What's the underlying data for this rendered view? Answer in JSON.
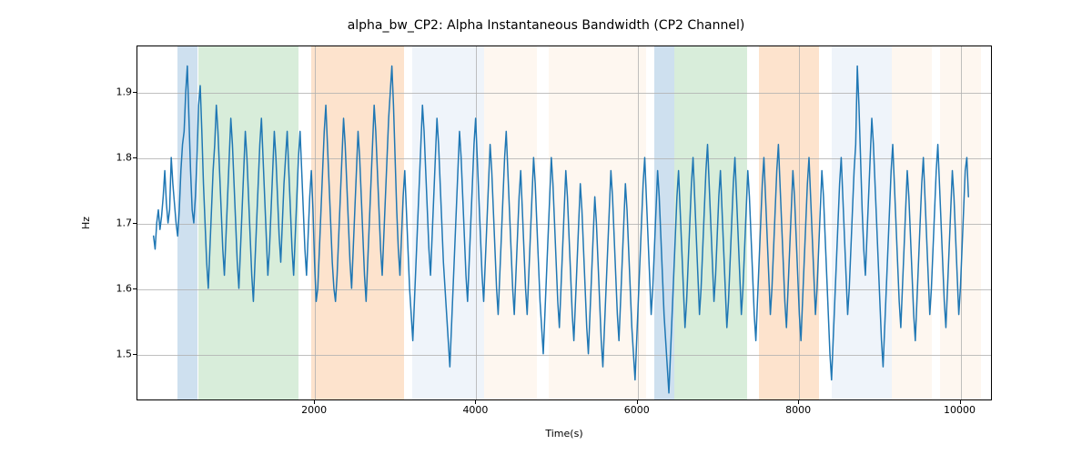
{
  "chart_data": {
    "type": "line",
    "title": "alpha_bw_CP2: Alpha Instantaneous Bandwidth (CP2 Channel)",
    "xlabel": "Time(s)",
    "ylabel": "Hz",
    "xlim": [
      -200,
      10400
    ],
    "ylim": [
      1.43,
      1.97
    ],
    "xticks": [
      2000,
      4000,
      6000,
      8000,
      10000
    ],
    "yticks": [
      1.5,
      1.6,
      1.7,
      1.8,
      1.9
    ],
    "grid": true,
    "line_color": "#1f77b4",
    "bands": [
      {
        "xmin": 300,
        "xmax": 550,
        "color": "#5e97c9"
      },
      {
        "xmin": 550,
        "xmax": 1800,
        "color": "#7dc383"
      },
      {
        "xmin": 1950,
        "xmax": 3100,
        "color": "#f7a15a"
      },
      {
        "xmin": 3200,
        "xmax": 4100,
        "color": "#c9dbee"
      },
      {
        "xmin": 4100,
        "xmax": 4750,
        "color": "#fde4cd"
      },
      {
        "xmin": 4900,
        "xmax": 6100,
        "color": "#fde4cd"
      },
      {
        "xmin": 6200,
        "xmax": 6450,
        "color": "#5e97c9"
      },
      {
        "xmin": 6450,
        "xmax": 7350,
        "color": "#7dc383"
      },
      {
        "xmin": 7500,
        "xmax": 8250,
        "color": "#f7a15a"
      },
      {
        "xmin": 8400,
        "xmax": 9150,
        "color": "#c9dbee"
      },
      {
        "xmin": 9150,
        "xmax": 9650,
        "color": "#fde4cd"
      },
      {
        "xmin": 9750,
        "xmax": 10250,
        "color": "#fde4cd"
      }
    ],
    "series": [
      {
        "name": "alpha_bw_CP2",
        "x_start": 0,
        "x_step": 20,
        "values": [
          1.68,
          1.66,
          1.7,
          1.72,
          1.69,
          1.71,
          1.74,
          1.78,
          1.73,
          1.7,
          1.72,
          1.8,
          1.76,
          1.73,
          1.7,
          1.68,
          1.72,
          1.78,
          1.82,
          1.84,
          1.9,
          1.94,
          1.86,
          1.78,
          1.72,
          1.7,
          1.74,
          1.8,
          1.88,
          1.91,
          1.84,
          1.76,
          1.7,
          1.64,
          1.6,
          1.66,
          1.72,
          1.78,
          1.82,
          1.88,
          1.84,
          1.78,
          1.72,
          1.66,
          1.62,
          1.68,
          1.74,
          1.8,
          1.86,
          1.82,
          1.76,
          1.7,
          1.64,
          1.6,
          1.66,
          1.72,
          1.78,
          1.84,
          1.8,
          1.74,
          1.68,
          1.62,
          1.58,
          1.64,
          1.7,
          1.76,
          1.82,
          1.86,
          1.8,
          1.74,
          1.68,
          1.62,
          1.66,
          1.72,
          1.78,
          1.84,
          1.8,
          1.74,
          1.68,
          1.64,
          1.7,
          1.76,
          1.8,
          1.84,
          1.78,
          1.72,
          1.66,
          1.62,
          1.68,
          1.74,
          1.8,
          1.84,
          1.78,
          1.72,
          1.66,
          1.62,
          1.68,
          1.74,
          1.78,
          1.72,
          1.64,
          1.58,
          1.6,
          1.66,
          1.72,
          1.78,
          1.84,
          1.88,
          1.82,
          1.76,
          1.7,
          1.64,
          1.6,
          1.58,
          1.62,
          1.68,
          1.74,
          1.8,
          1.86,
          1.82,
          1.76,
          1.7,
          1.64,
          1.6,
          1.66,
          1.72,
          1.78,
          1.84,
          1.8,
          1.74,
          1.68,
          1.62,
          1.58,
          1.64,
          1.7,
          1.76,
          1.82,
          1.88,
          1.84,
          1.78,
          1.72,
          1.66,
          1.62,
          1.68,
          1.74,
          1.8,
          1.86,
          1.9,
          1.94,
          1.88,
          1.8,
          1.72,
          1.66,
          1.62,
          1.68,
          1.74,
          1.78,
          1.72,
          1.66,
          1.6,
          1.56,
          1.52,
          1.58,
          1.64,
          1.7,
          1.76,
          1.82,
          1.88,
          1.84,
          1.78,
          1.72,
          1.66,
          1.62,
          1.68,
          1.74,
          1.8,
          1.86,
          1.82,
          1.76,
          1.7,
          1.64,
          1.6,
          1.56,
          1.52,
          1.48,
          1.54,
          1.6,
          1.66,
          1.72,
          1.78,
          1.84,
          1.8,
          1.74,
          1.68,
          1.62,
          1.58,
          1.64,
          1.7,
          1.76,
          1.82,
          1.86,
          1.8,
          1.74,
          1.68,
          1.62,
          1.58,
          1.64,
          1.7,
          1.76,
          1.82,
          1.78,
          1.72,
          1.66,
          1.6,
          1.56,
          1.62,
          1.68,
          1.74,
          1.8,
          1.84,
          1.78,
          1.72,
          1.66,
          1.6,
          1.56,
          1.62,
          1.68,
          1.74,
          1.78,
          1.72,
          1.66,
          1.6,
          1.56,
          1.62,
          1.68,
          1.74,
          1.8,
          1.76,
          1.7,
          1.64,
          1.58,
          1.54,
          1.5,
          1.56,
          1.62,
          1.68,
          1.74,
          1.8,
          1.76,
          1.7,
          1.64,
          1.58,
          1.54,
          1.6,
          1.66,
          1.72,
          1.78,
          1.74,
          1.68,
          1.62,
          1.56,
          1.52,
          1.58,
          1.64,
          1.7,
          1.76,
          1.72,
          1.66,
          1.6,
          1.54,
          1.5,
          1.56,
          1.62,
          1.68,
          1.74,
          1.7,
          1.64,
          1.58,
          1.52,
          1.48,
          1.54,
          1.6,
          1.66,
          1.72,
          1.78,
          1.74,
          1.68,
          1.62,
          1.56,
          1.52,
          1.58,
          1.64,
          1.7,
          1.76,
          1.72,
          1.66,
          1.6,
          1.54,
          1.5,
          1.46,
          1.52,
          1.58,
          1.64,
          1.7,
          1.76,
          1.8,
          1.74,
          1.68,
          1.62,
          1.56,
          1.6,
          1.66,
          1.72,
          1.78,
          1.74,
          1.68,
          1.62,
          1.56,
          1.52,
          1.48,
          1.44,
          1.5,
          1.56,
          1.62,
          1.68,
          1.74,
          1.78,
          1.72,
          1.66,
          1.6,
          1.54,
          1.58,
          1.64,
          1.7,
          1.76,
          1.8,
          1.74,
          1.68,
          1.62,
          1.56,
          1.6,
          1.66,
          1.72,
          1.78,
          1.82,
          1.76,
          1.7,
          1.64,
          1.58,
          1.62,
          1.68,
          1.74,
          1.78,
          1.72,
          1.66,
          1.6,
          1.54,
          1.58,
          1.64,
          1.7,
          1.76,
          1.8,
          1.74,
          1.68,
          1.62,
          1.56,
          1.6,
          1.66,
          1.72,
          1.78,
          1.74,
          1.68,
          1.62,
          1.56,
          1.52,
          1.58,
          1.64,
          1.7,
          1.76,
          1.8,
          1.74,
          1.68,
          1.62,
          1.56,
          1.6,
          1.66,
          1.72,
          1.78,
          1.82,
          1.76,
          1.7,
          1.64,
          1.58,
          1.54,
          1.6,
          1.66,
          1.72,
          1.78,
          1.74,
          1.68,
          1.62,
          1.56,
          1.52,
          1.58,
          1.64,
          1.7,
          1.76,
          1.8,
          1.74,
          1.68,
          1.62,
          1.56,
          1.6,
          1.66,
          1.72,
          1.78,
          1.74,
          1.68,
          1.62,
          1.56,
          1.5,
          1.46,
          1.52,
          1.58,
          1.64,
          1.7,
          1.76,
          1.8,
          1.74,
          1.68,
          1.62,
          1.56,
          1.6,
          1.66,
          1.72,
          1.78,
          1.82,
          1.94,
          1.88,
          1.8,
          1.72,
          1.66,
          1.62,
          1.68,
          1.74,
          1.8,
          1.86,
          1.82,
          1.76,
          1.7,
          1.64,
          1.58,
          1.52,
          1.48,
          1.54,
          1.6,
          1.66,
          1.72,
          1.78,
          1.82,
          1.76,
          1.7,
          1.64,
          1.58,
          1.54,
          1.6,
          1.66,
          1.72,
          1.78,
          1.74,
          1.68,
          1.62,
          1.56,
          1.52,
          1.58,
          1.64,
          1.7,
          1.76,
          1.8,
          1.74,
          1.68,
          1.62,
          1.56,
          1.6,
          1.66,
          1.72,
          1.78,
          1.82,
          1.76,
          1.7,
          1.64,
          1.58,
          1.54,
          1.6,
          1.66,
          1.72,
          1.78,
          1.74,
          1.68,
          1.62,
          1.56,
          1.6,
          1.66,
          1.72,
          1.78,
          1.8,
          1.74
        ]
      }
    ]
  }
}
